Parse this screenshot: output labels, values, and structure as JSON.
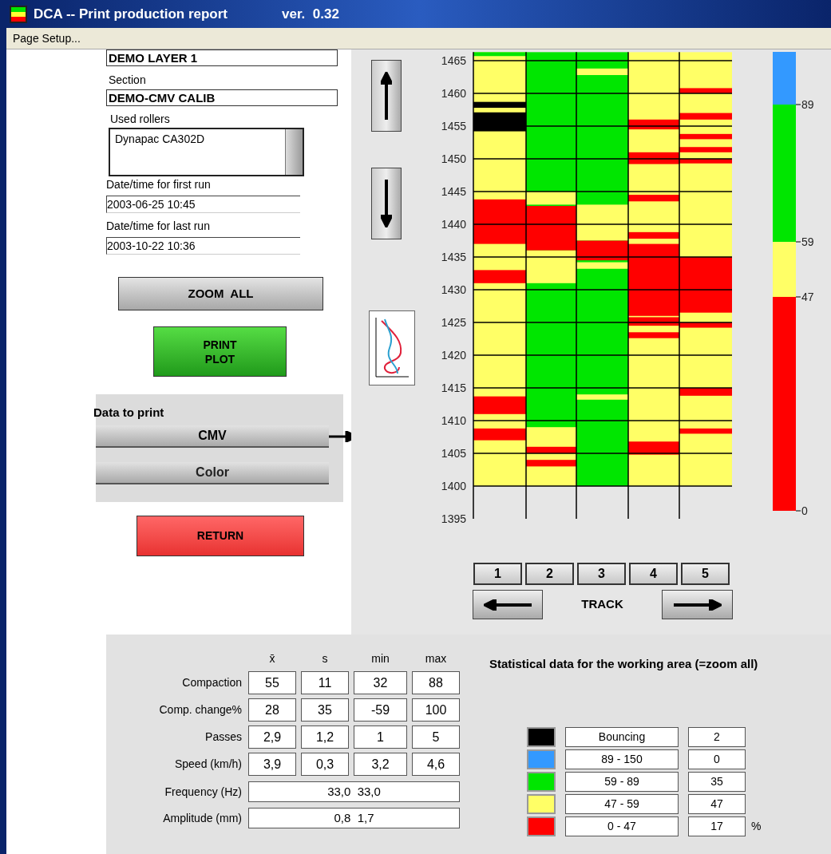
{
  "window": {
    "title": "DCA -- Print production report",
    "version": "ver.  0.32"
  },
  "menu": [
    "Page Setup..."
  ],
  "layer": {
    "value": "DEMO LAYER 1"
  },
  "section": {
    "label": "Section",
    "value": "DEMO-CMV CALIB"
  },
  "rollers": {
    "label": "Used rollers",
    "items": [
      "Dynapac  CA302D"
    ]
  },
  "first_run": {
    "label": "Date/time for first run",
    "value": "2003-06-25 10:45"
  },
  "last_run": {
    "label": "Date/time for last run",
    "value": "2003-10-22 10:36"
  },
  "zoom_all": "ZOOM  ALL",
  "print_plot": [
    "PRINT",
    "PLOT"
  ],
  "data_to_print": {
    "label": "Data to print",
    "options": [
      {
        "label": "CMV",
        "selected": true
      },
      {
        "label": "Color",
        "selected": false
      }
    ]
  },
  "return": "RETURN",
  "chart": {
    "y_labels": [
      "1465",
      "1460",
      "1455",
      "1450",
      "1445",
      "1440",
      "1435",
      "1430",
      "1425",
      "1420",
      "1415",
      "1410",
      "1405",
      "1400",
      "1395"
    ],
    "scale_labels": [
      "89",
      "59",
      "47",
      "0"
    ]
  },
  "tracks": [
    "1",
    "2",
    "3",
    "4",
    "5"
  ],
  "track_label": "TRACK",
  "stats": {
    "columns": [
      "x̄",
      "s",
      "min",
      "max"
    ],
    "rows": [
      {
        "label": "Compaction",
        "values": [
          "55",
          "11",
          "32",
          "88"
        ]
      },
      {
        "label": "Comp. change%",
        "values": [
          "28",
          "35",
          "-59",
          "100"
        ]
      },
      {
        "label": "Passes",
        "values": [
          "2,9",
          "1,2",
          "1",
          "5"
        ]
      },
      {
        "label": "Speed (km/h)",
        "values": [
          "3,9",
          "0,3",
          "3,2",
          "4,6"
        ]
      }
    ],
    "spans": [
      {
        "label": "Frequency (Hz)",
        "value": "33,0  33,0"
      },
      {
        "label": "Amplitude (mm)",
        "value": "0,8  1,7"
      }
    ]
  },
  "distribution": {
    "title": "Statistical data for the working area (=zoom all)",
    "unit": "%",
    "items": [
      {
        "label": "Bouncing",
        "value": "2",
        "color": "#000000"
      },
      {
        "label": "89 - 150",
        "value": "0",
        "color": "#3399ff"
      },
      {
        "label": "59 - 89",
        "value": "35",
        "color": "#00e600"
      },
      {
        "label": "47 - 59",
        "value": "47",
        "color": "#ffff66"
      },
      {
        "label": "0 - 47",
        "value": "17",
        "color": "#ff0000"
      }
    ]
  }
}
